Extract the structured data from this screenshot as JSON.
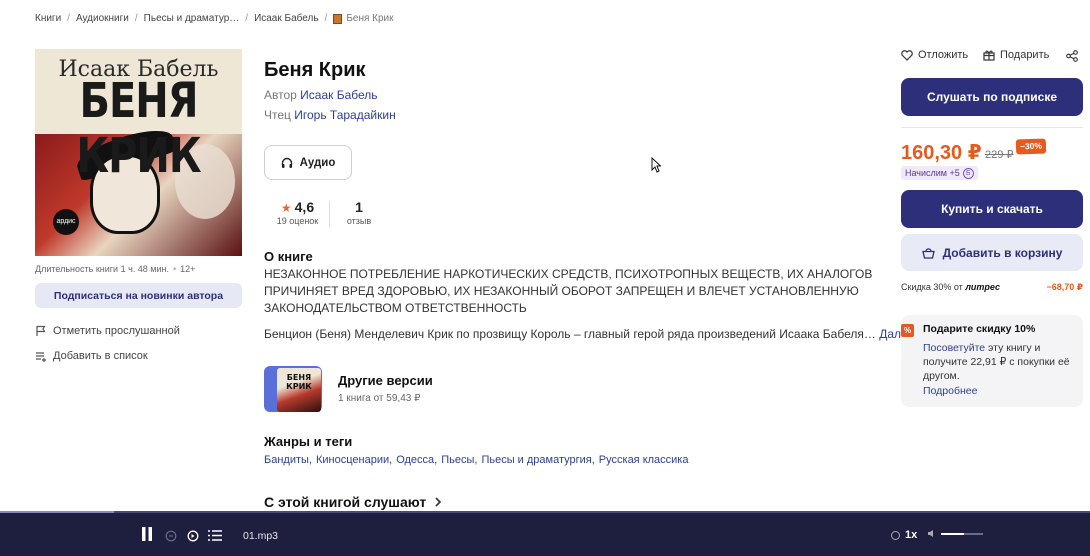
{
  "breadcrumb": {
    "items": [
      "Книги",
      "Аудиокниги",
      "Пьесы и драматур…",
      "Исаак Бабель"
    ],
    "current": "Беня Крик"
  },
  "cover": {
    "author": "Исаак Бабель",
    "title": "БЕНЯ КРИК",
    "publisher": "ардис"
  },
  "book": {
    "duration": "Длительность книги 1 ч. 48 мин.",
    "age": "12+",
    "title": "Беня Крик",
    "author_label": "Автор",
    "author": "Исаак Бабель",
    "reader_label": "Чтец",
    "reader": "Игорь Тарадайкин",
    "format_button": "Аудио",
    "rating": "4,6",
    "rating_sub": "19 оценок",
    "reviews": "1",
    "reviews_sub": "отзыв"
  },
  "sidebar": {
    "subscribe_author": "Подписаться на новинки автора",
    "mark_listened": "Отметить прослушанной",
    "add_to_list": "Добавить в список"
  },
  "about": {
    "heading": "О книге",
    "warning": "НЕЗАКОННОЕ ПОТРЕБЛЕНИЕ НАРКОТИЧЕСКИХ СРЕДСТВ, ПСИХОТРОПНЫХ ВЕЩЕСТВ, ИХ АНАЛОГОВ ПРИЧИНЯЕТ ВРЕД ЗДОРОВЬЮ, ИХ НЕЗАКОННЫЙ ОБОРОТ ЗАПРЕЩЕН И ВЛЕЧЕТ УСТАНОВЛЕННУЮ ЗАКОНОДАТЕЛЬСТВОМ ОТВЕТСТВЕННОСТЬ",
    "description": "Бенцион (Беня) Менделевич Крик по прозвищу Король – главный герой ряда произведений Исаака Бабеля…",
    "more_link": "Далее"
  },
  "other_versions": {
    "cover_text": "БЕНЯ КРИК",
    "title": "Другие версии",
    "subtitle": "1 книга от 59,43 ₽"
  },
  "genres": {
    "heading": "Жанры и теги",
    "tags": [
      "Бандиты",
      "Киносценарии",
      "Одесса",
      "Пьесы",
      "Пьесы и драматургия",
      "Русская классика"
    ]
  },
  "listen_with": {
    "heading": "С этой книгой слушают"
  },
  "right": {
    "postpone": "Отложить",
    "gift": "Подарить",
    "listen_subscription": "Слушать по подписке",
    "price": "160,30 ₽",
    "old_price": "229 ₽",
    "discount": "−30%",
    "bonus": "Начислим +5",
    "buy": "Купить и скачать",
    "add_cart": "Добавить в корзину",
    "litres_discount": "Скидка 30% от",
    "litres_brand": "литрес",
    "litres_amount": "−68,70 ₽",
    "gift_heading": "Подарите скидку 10%",
    "gift_link": "Посоветуйте",
    "gift_text": " эту книгу и получите 22,91 ₽ с покупки её другом.",
    "gift_more": "Подробнее"
  },
  "player": {
    "file": "01.mp3",
    "speed": "1x",
    "progress": 0.105,
    "volume": 0.55
  },
  "colors": {
    "primary": "#2d2f7a",
    "accent": "#e55b1f",
    "link": "#2d3f8f",
    "player_bg": "#1e1e3f"
  }
}
